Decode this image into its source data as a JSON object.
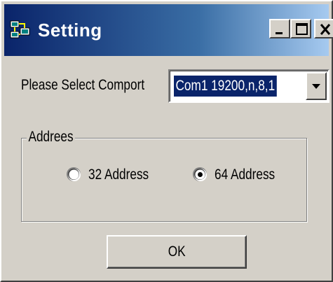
{
  "window": {
    "title": "Setting",
    "icon": "app-settings-icon",
    "title_gradient": [
      "#0a246a",
      "#a6caf0"
    ],
    "caption_buttons": [
      "minimize-icon",
      "maximize-icon",
      "close-icon"
    ]
  },
  "comport": {
    "label": "Please Select Comport",
    "selected_value": "Com1 19200,n,8,1"
  },
  "address_group": {
    "label": "Addrees",
    "options": [
      {
        "label": "32 Address",
        "checked": false
      },
      {
        "label": "64 Address",
        "checked": true
      }
    ]
  },
  "ok_button": {
    "label": "OK"
  }
}
